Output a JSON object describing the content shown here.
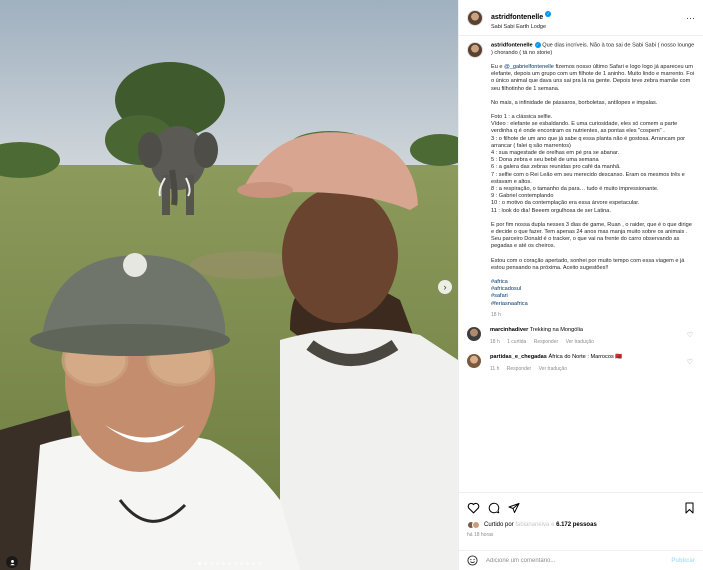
{
  "post": {
    "username": "astridfontenelle",
    "location": "Sabi Sabi Earth Lodge",
    "more_label": "···"
  },
  "caption": {
    "username": "astridfontenelle",
    "intro": "Que dias incríveis. Não à toa sai de Sabi Sabi ( nosso lounge ) chorando ( tá no storie)",
    "p2_a": "Eu e ",
    "p2_mention": "@_gabrielfontenelle",
    "p2_b": " fizemos nosso último Safari e logo logo já apareceu um elefante, depois um grupo com um filhote de 1 aninho. Muito lindo e marrento. Foi o único animal que dava uns sai pra lá na gente. Depois teve zebra mamãe com seu filhotinho de 1 semana.",
    "p3": "No mais, a infinidade de pássaros, borboletas, antílopes e impalas.",
    "list": [
      "Foto 1 : a clássica selfie.",
      "Vídeo : elefante se esbaldando. E uma curiosidade, eles só comem a parte verdinha q é onde encontram os nutrientes, as pontas eles \"cospem\" .",
      "3 : o filhote de um ano que já sabe q essa planta não é gostosa. Arrancam por arrancar ( falei q são marrentos)",
      "4 : sua magestade de orelhas em pé pra se abanar.",
      "5 : Dona zebra e seu bebê de uma semana",
      "6 : a galera das zebras reunidas pro café da manhã.",
      "7 : selfie com o Rei Leão em seu merecido descanso. Eram os mesmos três e estavam e altos.",
      "8 : a respiração, o tamanho da para… tudo é muito impressionante.",
      "9 : Gabriel contemplando",
      "10 : o motivo da contemplação era essa árvore espetacular.",
      "11 : look do dia! Beeem orgulhosa de ser Latina."
    ],
    "p5": "E por fim nossa dupla nesses 3 dias de game, Ruan , o raider, que é o que dirige e decide o que fazer. Tem apenas 24 anos mas manja muito sobre os animais . Seu parceiro Donald é o tracker, o que vai na frente do carro observando as pegadas e até os cheiros.",
    "p6": "Estou com o coração apertado, sonhei por muito tempo com essa viagem e já estou pensando na próxima. Aceito sugestões!!",
    "hashtags": [
      "#africa",
      "#africadosul",
      "#safari",
      "#feriasnaafrica"
    ],
    "time": "18 h"
  },
  "comments": [
    {
      "username": "marcinhadiver",
      "text": "Trekking na Mongólia",
      "time": "18 h",
      "likes": "1 curtida",
      "reply": "Responder",
      "translate": "Ver tradução"
    },
    {
      "username": "partidas_e_chegadas",
      "text": "África do Norte : Marrocos 🇲🇦",
      "time": "11 h",
      "likes": "",
      "reply": "Responder",
      "translate": "Ver tradução"
    }
  ],
  "likes": {
    "prefix": "Curtido por",
    "liker": "fabiananeiva",
    "mid": "e",
    "count": "6.172 pessoas"
  },
  "post_age": "há 18 horas",
  "add_comment": {
    "placeholder": "Adicione um comentário...",
    "publish": "Publicar"
  },
  "colors": {
    "accent": "#0095f6",
    "link": "#00376b",
    "muted": "#8e8e8e"
  }
}
